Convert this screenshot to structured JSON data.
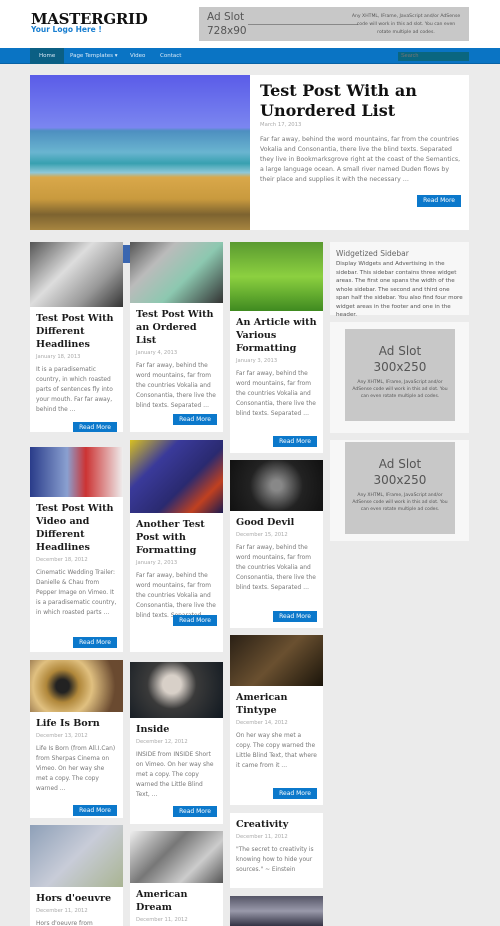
{
  "header": {
    "logo": "MASTERGRID",
    "tagline": "Your Logo Here !",
    "ad": {
      "line1": "Ad Slot",
      "line2": "728x90",
      "text": "Any XHTML, IFrame, JavaScript and/or AdSense code will work in this ad slot. You can even rotate multiple ad codes."
    }
  },
  "nav": {
    "items": [
      {
        "label": "Home",
        "active": true
      },
      {
        "label": "Page Templates ▾"
      },
      {
        "label": "Video"
      },
      {
        "label": "Contact"
      }
    ],
    "search_placeholder": "Search"
  },
  "featured": {
    "title": "Test Post With an Unordered List",
    "date": "March 17, 2013",
    "excerpt": "Far far away, behind the word mountains, far from the countries Vokalia and Consonantia, there live the blind texts. Separated they live in Bookmarksgrove right at the coast of the Semantics, a large language ocean. A small river named Duden flows by their place and supplies it with the necessary …",
    "button": "Read More"
  },
  "columns": [
    [
      {
        "title": "Test Post With Different Headlines",
        "date": "January 18, 2013",
        "excerpt": "It is a paradisematic country, in which roasted parts of sentences fly into your mouth. Far far away, behind the …",
        "button": "Read More"
      },
      {
        "title": "Test Post With Video and Different Headlines",
        "date": "December 18, 2012",
        "excerpt": "Cinematic Wedding Trailer: Danielle & Chau from Pepper Image on Vimeo. It is a paradisematic country, in which roasted parts …",
        "button": "Read More"
      },
      {
        "title": "Life Is Born",
        "date": "December 13, 2012",
        "excerpt": "Life Is Born (from All.I.Can) from Sherpas Cinema on Vimeo. On her way she met a copy. The copy warned …",
        "button": "Read More"
      },
      {
        "title": "Hors d'oeuvre",
        "date": "December 11, 2012",
        "excerpt": "Hors d'oeuvre from MONICA"
      }
    ],
    [
      {
        "title": "Test Post With an Ordered List",
        "date": "January 4, 2013",
        "excerpt": "Far far away, behind the word mountains, far from the countries Vokalia and Consonantia, there live the blind texts. Separated …",
        "button": "Read More"
      },
      {
        "title": "Another Test Post with Formatting",
        "date": "January 2, 2013",
        "excerpt": "Far far away, behind the word mountains, far from the countries Vokalia and Consonantia, there live the blind texts. Separated …",
        "button": "Read More"
      },
      {
        "title": "Inside",
        "date": "December 12, 2012",
        "excerpt": "INSIDE from INSIDE Short on Vimeo. On her way she met a copy. The copy warned the Little Blind Text, …",
        "button": "Read More"
      },
      {
        "title": "American Dream",
        "date": "December 11, 2012",
        "excerpt": "American Dream from Ian"
      }
    ],
    [
      {
        "title": "An Article with Various Formatting",
        "date": "January 3, 2013",
        "excerpt": "Far far away, behind the word mountains, far from the countries Vokalia and Consonantia, there live the blind texts. Separated …",
        "button": "Read More"
      },
      {
        "title": "Good Devil",
        "date": "December 15, 2012",
        "excerpt": "Far far away, behind the word mountains, far from the countries Vokalia and Consonantia, there live the blind texts. Separated …",
        "button": "Read More"
      },
      {
        "title": "American Tintype",
        "date": "December 14, 2012",
        "excerpt": "On her way she met a copy. The copy warned the Little Blind Text, that where it came from it …",
        "button": "Read More"
      },
      {
        "title": "Creativity",
        "date": "December 11, 2012",
        "excerpt": "\"The secret to creativity is knowing how to hide your sources.\" ~ Einstein"
      },
      {
        "title": "",
        "date": "",
        "excerpt": ""
      }
    ]
  ],
  "sidebar": {
    "widget_title": "Widgetized Sidebar",
    "widget_text": "Display Widgets and Advertising in the sidebar. This sidebar contains three widget areas. The first one spans the width of the whole sidebar. The second and third one span half the sidebar. You also find four more widget areas in the footer and one in the header.",
    "ads": [
      {
        "line1": "Ad Slot",
        "line2": "300x250",
        "text": "Any XHTML, IFrame, JavaScript and/or AdSense code will work in this ad slot. You can even rotate multiple ad codes."
      },
      {
        "line1": "Ad Slot",
        "line2": "300x250",
        "text": "Any XHTML, IFrame, JavaScript and/or AdSense code will work in this ad slot. You can even rotate multiple ad codes."
      }
    ]
  },
  "colors": {
    "accent": "#0b78cb",
    "nav": "#0a74c4",
    "nav_active": "#0b5f84",
    "background": "#ebebeb"
  }
}
